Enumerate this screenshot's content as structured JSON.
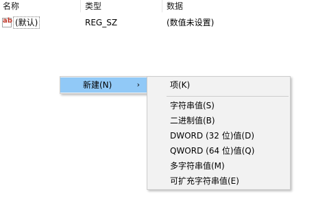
{
  "columns": {
    "name": "名称",
    "type": "类型",
    "data": "数据"
  },
  "value_row": {
    "icon_text": "ab",
    "name": "(默认)",
    "type": "REG_SZ",
    "data": "(数值未设置)"
  },
  "context_menu": {
    "items": [
      {
        "label": "新建(N)",
        "has_submenu": true,
        "arrow": "›"
      }
    ]
  },
  "new_submenu": {
    "items": [
      {
        "label": "项(K)"
      },
      {
        "label": "字符串值(S)"
      },
      {
        "label": "二进制值(B)"
      },
      {
        "label": "DWORD (32 位)值(D)"
      },
      {
        "label": "QWORD (64 位)值(Q)"
      },
      {
        "label": "多字符串值(M)"
      },
      {
        "label": "可扩充字符串值(E)"
      }
    ]
  },
  "colors": {
    "menu_background": "#f2f2f2",
    "menu_highlight": "#91c9f7",
    "icon_ab": "#c0392b"
  }
}
